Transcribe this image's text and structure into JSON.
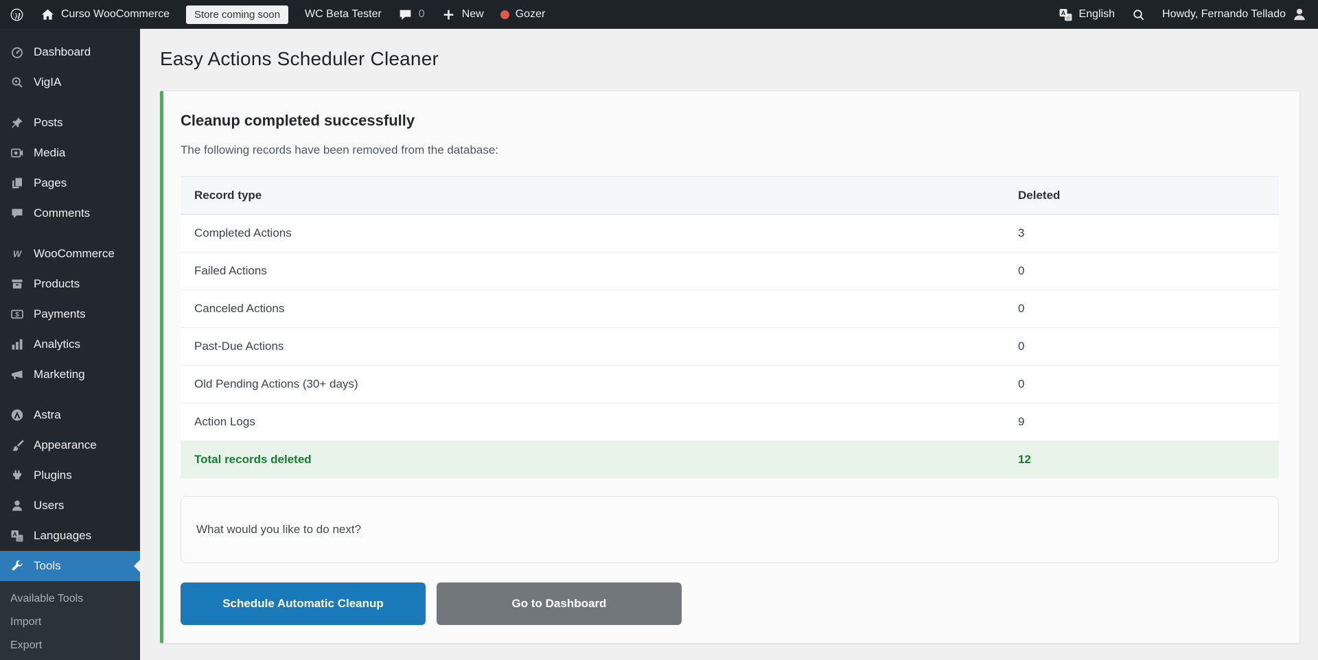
{
  "admin_bar": {
    "site_name": "Curso WooCommerce",
    "coming_soon_badge": "Store coming soon",
    "wc_beta_tester": "WC Beta Tester",
    "comments_count": "0",
    "new_label": "New",
    "gozer_label": "Gozer",
    "language_label": "English",
    "howdy_label": "Howdy, Fernando Tellado"
  },
  "sidebar": {
    "items": [
      {
        "label": "Dashboard",
        "icon": "dashboard-icon"
      },
      {
        "label": "VigIA",
        "icon": "viga-icon"
      },
      {
        "label": "Posts",
        "icon": "posts-icon",
        "separator": true
      },
      {
        "label": "Media",
        "icon": "media-icon"
      },
      {
        "label": "Pages",
        "icon": "pages-icon"
      },
      {
        "label": "Comments",
        "icon": "comments-icon"
      },
      {
        "label": "WooCommerce",
        "icon": "woocommerce-icon",
        "separator": true
      },
      {
        "label": "Products",
        "icon": "products-icon"
      },
      {
        "label": "Payments",
        "icon": "payments-icon"
      },
      {
        "label": "Analytics",
        "icon": "analytics-icon"
      },
      {
        "label": "Marketing",
        "icon": "marketing-icon"
      },
      {
        "label": "Astra",
        "icon": "astra-icon",
        "separator": true
      },
      {
        "label": "Appearance",
        "icon": "appearance-icon"
      },
      {
        "label": "Plugins",
        "icon": "plugins-icon"
      },
      {
        "label": "Users",
        "icon": "users-icon"
      },
      {
        "label": "Languages",
        "icon": "languages-icon"
      },
      {
        "label": "Tools",
        "icon": "tools-icon",
        "active": true,
        "submenu": [
          "Available Tools",
          "Import",
          "Export"
        ]
      }
    ]
  },
  "page": {
    "title": "Easy Actions Scheduler Cleaner"
  },
  "notice": {
    "heading": "Cleanup completed successfully",
    "description": "The following records have been removed from the database:",
    "table": {
      "headers": [
        "Record type",
        "Deleted"
      ],
      "rows": [
        [
          "Completed Actions",
          "3"
        ],
        [
          "Failed Actions",
          "0"
        ],
        [
          "Canceled Actions",
          "0"
        ],
        [
          "Past-Due Actions",
          "0"
        ],
        [
          "Old Pending Actions (30+ days)",
          "0"
        ],
        [
          "Action Logs",
          "9"
        ]
      ],
      "total_label": "Total records deleted",
      "total_value": "12"
    },
    "next_prompt": "What would you like to do next?",
    "buttons": [
      {
        "label": "Schedule Automatic Cleanup",
        "style": "primary"
      },
      {
        "label": "Go to Dashboard",
        "style": "secondary"
      }
    ]
  },
  "colors": {
    "admin_bar_bg": "#1d2327",
    "sidebar_bg": "#23282e",
    "submenu_bg": "#2c3338",
    "active_menu_blue": "#2d7cb9",
    "success_green": "#3eb750",
    "total_row_bg": "#e8f4ea",
    "total_row_text": "#1c7a33",
    "primary_button": "#1a7ab9",
    "secondary_button": "#72777c",
    "page_bg": "#f0f0f1",
    "card_bg": "#fbfbfc"
  }
}
